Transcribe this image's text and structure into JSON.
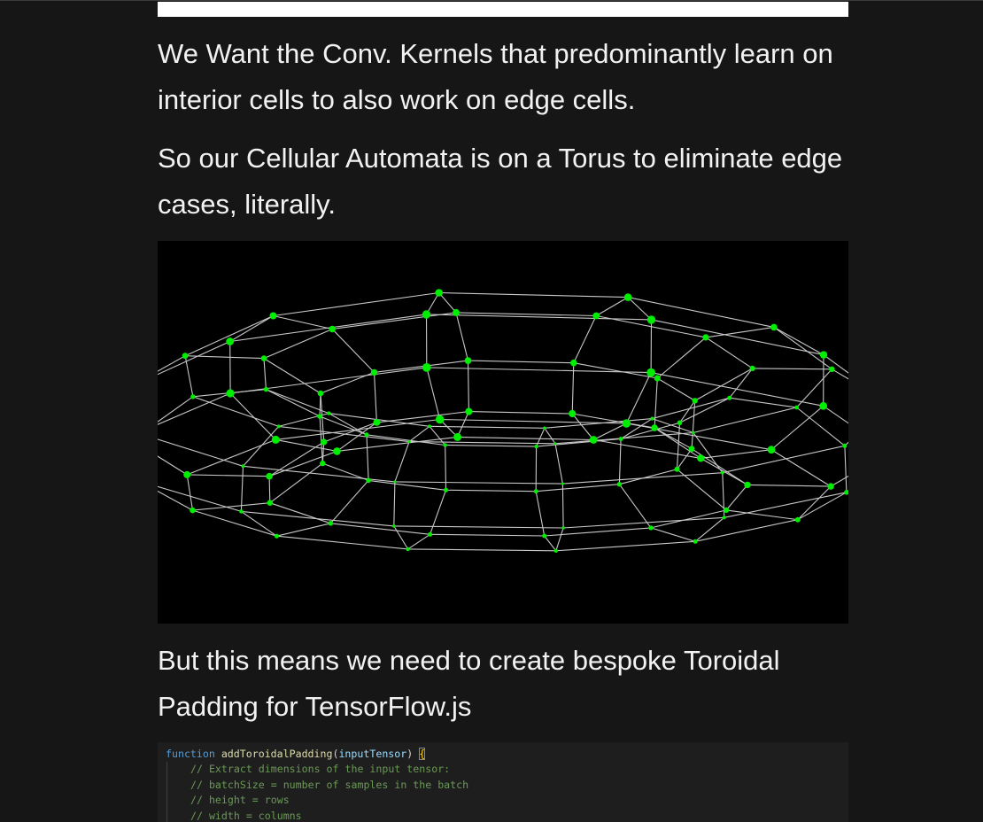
{
  "article": {
    "paragraph_1": "We Want the Conv. Kernels that predominantly learn on interior cells to also work on edge cells.",
    "paragraph_2": "So our Cellular Automata is on a Torus to eliminate edge cases, literally.",
    "paragraph_3": "But this means we need to create bespoke Toroidal Padding for TensorFlow.js"
  },
  "figure": {
    "type": "torus-wireframe",
    "colors": {
      "background": "#000000",
      "edges": "#c8c8c8",
      "nodes": "#00ee00"
    }
  },
  "code": {
    "keyword": "function",
    "function_name": "addToroidalPadding",
    "open_paren": "(",
    "parameter": "inputTensor",
    "close_paren": ")",
    "open_brace": "{",
    "comments": [
      "// Extract dimensions of the input tensor:",
      "// batchSize = number of samples in the batch",
      "// height = rows",
      "// width = columns"
    ]
  },
  "colors": {
    "page_background": "#161616",
    "text": "#f2f2f2",
    "code_background": "#1e1e1e"
  }
}
